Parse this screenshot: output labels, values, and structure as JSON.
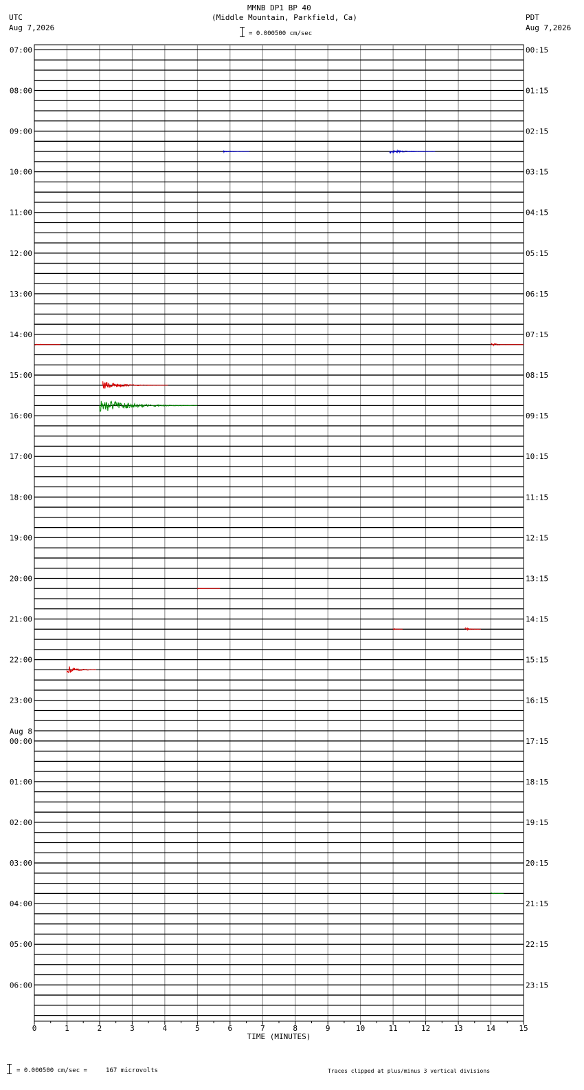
{
  "header": {
    "station": "MMNB DP1 BP 40",
    "location": "(Middle Mountain, Parkfield, Ca)",
    "scale_label": "= 0.000500 cm/sec",
    "left_tz": "UTC",
    "left_date": "Aug 7,2026",
    "right_tz": "PDT",
    "right_date": "Aug 7,2026"
  },
  "footer": {
    "scale_text": "= 0.000500 cm/sec =     167 microvolts",
    "clip_note": "Traces clipped at plus/minus 3 vertical divisions"
  },
  "chart_data": {
    "type": "seismogram",
    "xlabel": "TIME (MINUTES)",
    "xlim": [
      0,
      15
    ],
    "x_ticks": [
      0,
      1,
      2,
      3,
      4,
      5,
      6,
      7,
      8,
      9,
      10,
      11,
      12,
      13,
      14,
      15
    ],
    "trace_count": 96,
    "trace_minutes": 15,
    "trace_colors": [
      "#000000",
      "#dd0000",
      "#0000cc",
      "#008800"
    ],
    "left_labels": [
      "07:00",
      "08:00",
      "09:00",
      "10:00",
      "11:00",
      "12:00",
      "13:00",
      "14:00",
      "15:00",
      "16:00",
      "17:00",
      "18:00",
      "19:00",
      "20:00",
      "21:00",
      "22:00",
      "23:00",
      "00:00",
      "01:00",
      "02:00",
      "03:00",
      "04:00",
      "05:00",
      "06:00"
    ],
    "date_change_label": "Aug 8",
    "right_labels": [
      "00:15",
      "01:15",
      "02:15",
      "03:15",
      "04:15",
      "05:15",
      "06:15",
      "07:15",
      "08:15",
      "09:15",
      "10:15",
      "11:15",
      "12:15",
      "13:15",
      "14:15",
      "15:15",
      "16:15",
      "17:15",
      "18:15",
      "19:15",
      "20:15",
      "21:15",
      "22:15",
      "23:15"
    ],
    "events": [
      {
        "trace": 10,
        "minute": 5.8,
        "duration": 0.8,
        "amplitude": 1.5
      },
      {
        "trace": 10,
        "minute": 10.9,
        "duration": 1.4,
        "amplitude": 3
      },
      {
        "trace": 29,
        "minute": 0.0,
        "duration": 0.8,
        "amplitude": 1
      },
      {
        "trace": 29,
        "minute": 14.0,
        "duration": 1.0,
        "amplitude": 2
      },
      {
        "trace": 33,
        "minute": 2.1,
        "duration": 2.0,
        "amplitude": 6
      },
      {
        "trace": 35,
        "minute": 2.0,
        "duration": 3.0,
        "amplitude": 12
      },
      {
        "trace": 53,
        "minute": 5.0,
        "duration": 0.7,
        "amplitude": 1
      },
      {
        "trace": 57,
        "minute": 11.0,
        "duration": 0.3,
        "amplitude": 1.5
      },
      {
        "trace": 57,
        "minute": 13.2,
        "duration": 0.5,
        "amplitude": 2.5
      },
      {
        "trace": 61,
        "minute": 1.0,
        "duration": 0.9,
        "amplitude": 7
      },
      {
        "trace": 83,
        "minute": 14.0,
        "duration": 0.4,
        "amplitude": 1
      }
    ]
  }
}
